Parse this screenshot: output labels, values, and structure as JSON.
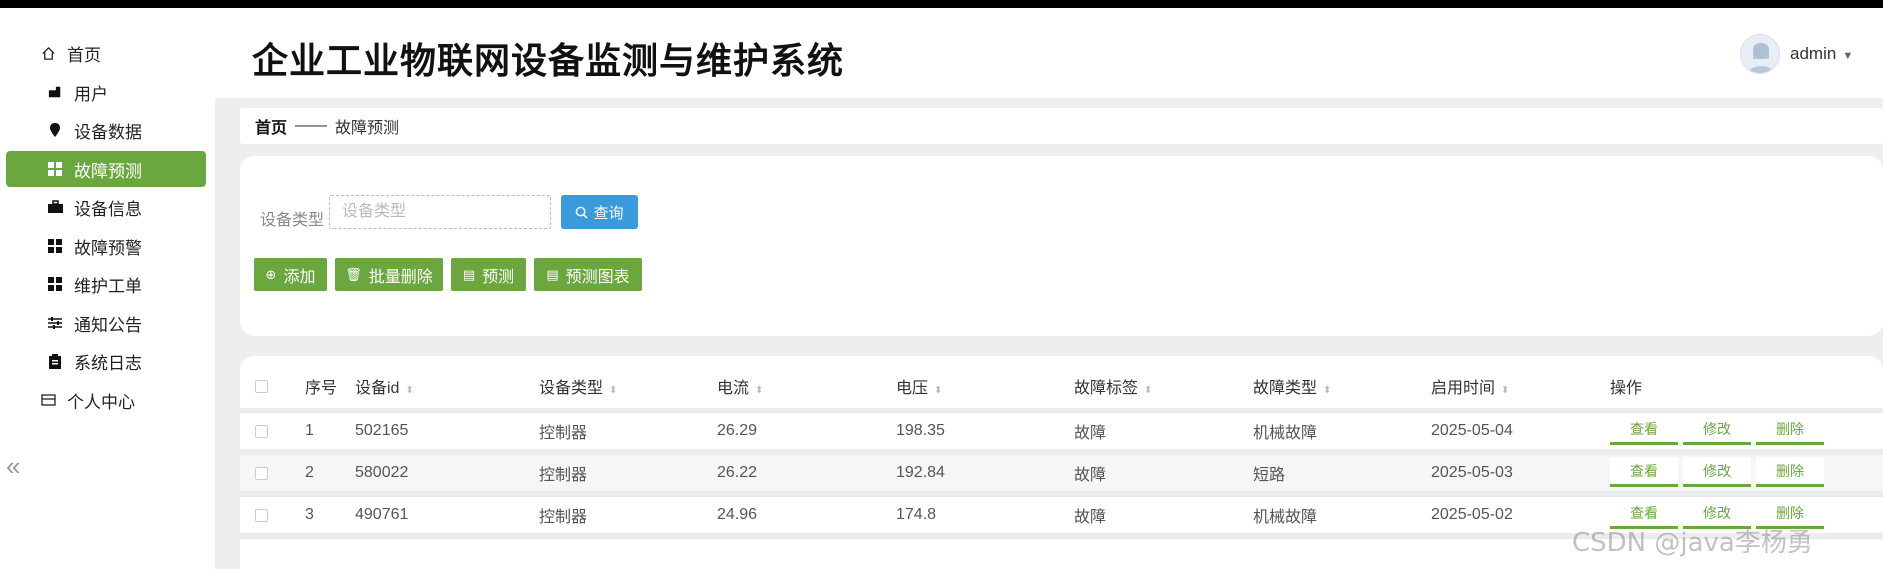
{
  "app": {
    "title": "企业工业物联网设备监测与维护系统",
    "user": "admin"
  },
  "sidebar": {
    "items": [
      {
        "label": "首页"
      },
      {
        "label": "用户"
      },
      {
        "label": "设备数据"
      },
      {
        "label": "故障预测"
      },
      {
        "label": "设备信息"
      },
      {
        "label": "故障预警"
      },
      {
        "label": "维护工单"
      },
      {
        "label": "通知公告"
      },
      {
        "label": "系统日志"
      },
      {
        "label": "个人中心"
      }
    ]
  },
  "breadcrumb": {
    "home": "首页",
    "separator": "——",
    "current": "故障预测"
  },
  "search": {
    "label": "设备类型",
    "placeholder": "设备类型",
    "query_label": "查询"
  },
  "actions": {
    "add": "添加",
    "batch_delete": "批量删除",
    "predict": "预测",
    "predict_chart": "预测图表"
  },
  "table": {
    "columns": [
      "序号",
      "设备id",
      "设备类型",
      "电流",
      "电压",
      "故障标签",
      "故障类型",
      "启用时间",
      "操作"
    ],
    "rows": [
      {
        "idx": "1",
        "device_id": "502165",
        "type": "控制器",
        "current": "26.29",
        "voltage": "198.35",
        "label": "故障",
        "fault": "机械故障",
        "date": "2025-05-04"
      },
      {
        "idx": "2",
        "device_id": "580022",
        "type": "控制器",
        "current": "26.22",
        "voltage": "192.84",
        "label": "故障",
        "fault": "短路",
        "date": "2025-05-03"
      },
      {
        "idx": "3",
        "device_id": "490761",
        "type": "控制器",
        "current": "24.96",
        "voltage": "174.8",
        "label": "故障",
        "fault": "机械故障",
        "date": "2025-05-02"
      }
    ],
    "ops": {
      "view": "查看",
      "edit": "修改",
      "delete": "删除"
    }
  },
  "watermark": "CSDN @java李杨勇",
  "colors": {
    "accent": "#6aa83f",
    "query": "#3a9bdc"
  }
}
